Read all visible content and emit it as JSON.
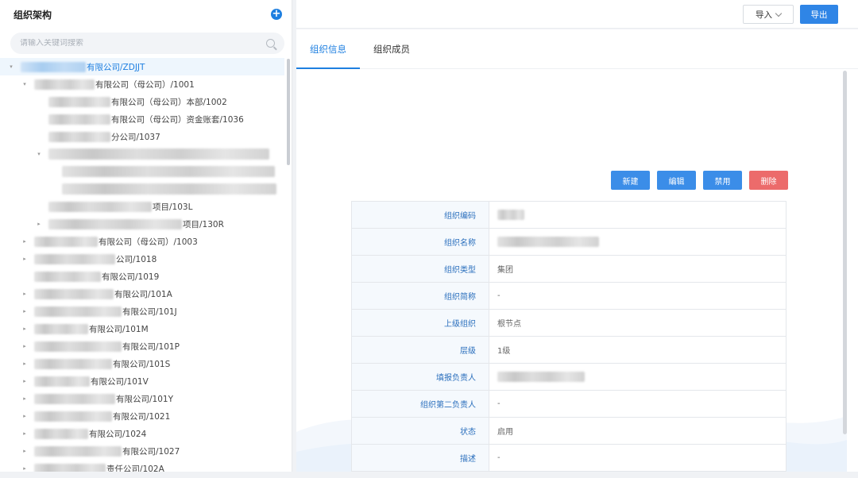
{
  "left_panel": {
    "title": "组织架构",
    "add_symbol": "+",
    "search_placeholder": "请输入关键词搜索",
    "tree": [
      {
        "label": "有限公司/ZDJJT",
        "indent": 0,
        "caret": "▾",
        "selected": true,
        "blur_widths": [
          82
        ]
      },
      {
        "label": "有限公司（母公司）/1001",
        "indent": 1,
        "caret": "▾",
        "blur_widths": [
          76
        ]
      },
      {
        "label": "有限公司（母公司）本部/1002",
        "indent": 2,
        "caret": "",
        "blur_widths": [
          78
        ]
      },
      {
        "label": "有限公司（母公司）资金账套/1036",
        "indent": 2,
        "caret": "",
        "blur_widths": [
          78
        ]
      },
      {
        "label": "分公司/1037",
        "indent": 2,
        "caret": "",
        "blur_widths": [
          78
        ]
      },
      {
        "label": "",
        "indent": 2,
        "caret": "▾",
        "blur_widths": [
          278
        ]
      },
      {
        "label": "",
        "indent": 3,
        "caret": "",
        "blur_widths": [
          268
        ]
      },
      {
        "label": "",
        "indent": 3,
        "caret": "",
        "blur_widths": [
          270
        ]
      },
      {
        "label": "项目/103L",
        "indent": 2,
        "caret": "",
        "blur_widths": [
          130
        ]
      },
      {
        "label": "项目/130R",
        "indent": 2,
        "caret": "▸",
        "blur_widths": [
          168
        ]
      },
      {
        "label": "有限公司（母公司）/1003",
        "indent": 1,
        "caret": "▸",
        "blur_widths": [
          80
        ]
      },
      {
        "label": "公司/1018",
        "indent": 1,
        "caret": "▸",
        "blur_widths": [
          102
        ]
      },
      {
        "label": "有限公司/1019",
        "indent": 1,
        "caret": "",
        "blur_widths": [
          84
        ]
      },
      {
        "label": "有限公司/101A",
        "indent": 1,
        "caret": "▸",
        "blur_widths": [
          100
        ]
      },
      {
        "label": "有限公司/101J",
        "indent": 1,
        "caret": "▸",
        "blur_widths": [
          110
        ]
      },
      {
        "label": "有限公司/101M",
        "indent": 1,
        "caret": "▸",
        "blur_widths": [
          68
        ]
      },
      {
        "label": "有限公司/101P",
        "indent": 1,
        "caret": "▸",
        "blur_widths": [
          110
        ]
      },
      {
        "label": "有限公司/101S",
        "indent": 1,
        "caret": "▸",
        "blur_widths": [
          98
        ]
      },
      {
        "label": "有限公司/101V",
        "indent": 1,
        "caret": "▸",
        "blur_widths": [
          70
        ]
      },
      {
        "label": "有限公司/101Y",
        "indent": 1,
        "caret": "▸",
        "blur_widths": [
          102
        ]
      },
      {
        "label": "有限公司/1021",
        "indent": 1,
        "caret": "▸",
        "blur_widths": [
          98
        ]
      },
      {
        "label": "有限公司/1024",
        "indent": 1,
        "caret": "▸",
        "blur_widths": [
          68
        ]
      },
      {
        "label": "有限公司/1027",
        "indent": 1,
        "caret": "▸",
        "blur_widths": [
          110
        ]
      },
      {
        "label": "责任公司/102A",
        "indent": 1,
        "caret": "▸",
        "blur_widths": [
          90
        ]
      }
    ]
  },
  "topbar": {
    "import_label": "导入",
    "export_label": "导出"
  },
  "tabs": [
    {
      "label": "组织信息",
      "active": true
    },
    {
      "label": "组织成员",
      "active": false
    }
  ],
  "actions": {
    "new": "新建",
    "edit": "编辑",
    "disable": "禁用",
    "delete": "删除"
  },
  "info_rows": [
    {
      "key": "组织编码",
      "value": "",
      "blur_width": 34
    },
    {
      "key": "组织名称",
      "value": "",
      "blur_width": 128
    },
    {
      "key": "组织类型",
      "value": "集团"
    },
    {
      "key": "组织简称",
      "value": "-"
    },
    {
      "key": "上级组织",
      "value": "根节点"
    },
    {
      "key": "层级",
      "value": "1级"
    },
    {
      "key": "填报负责人",
      "value": "",
      "blur_width": 110
    },
    {
      "key": "组织第二负责人",
      "value": "-"
    },
    {
      "key": "状态",
      "value": "启用"
    },
    {
      "key": "描述",
      "value": "-"
    }
  ],
  "colors": {
    "accent": "#1e7fe0",
    "danger": "#ec6b6b"
  }
}
